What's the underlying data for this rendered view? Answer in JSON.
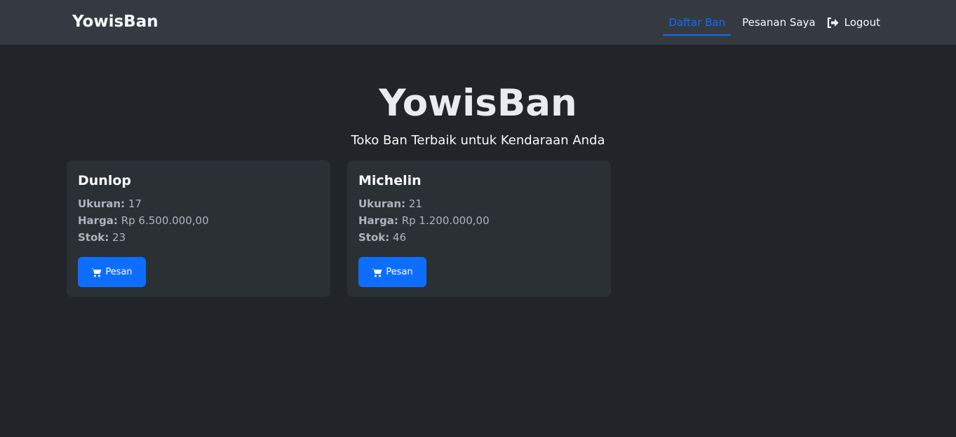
{
  "nav": {
    "brand": "YowisBan",
    "links": [
      {
        "label": "Daftar Ban"
      },
      {
        "label": "Pesanan Saya"
      },
      {
        "label": "Logout"
      }
    ]
  },
  "hero": {
    "title": "YowisBan",
    "subtitle": "Toko Ban Terbaik untuk Kendaraan Anda"
  },
  "labels": {
    "size": "Ukuran:",
    "price": "Harga:",
    "stock": "Stok:",
    "order": "Pesan"
  },
  "products": [
    {
      "name": "Dunlop",
      "size": "17",
      "price": "Rp 6.500.000,00",
      "stock": "23"
    },
    {
      "name": "Michelin",
      "size": "21",
      "price": "Rp 1.200.000,00",
      "stock": "46"
    }
  ]
}
